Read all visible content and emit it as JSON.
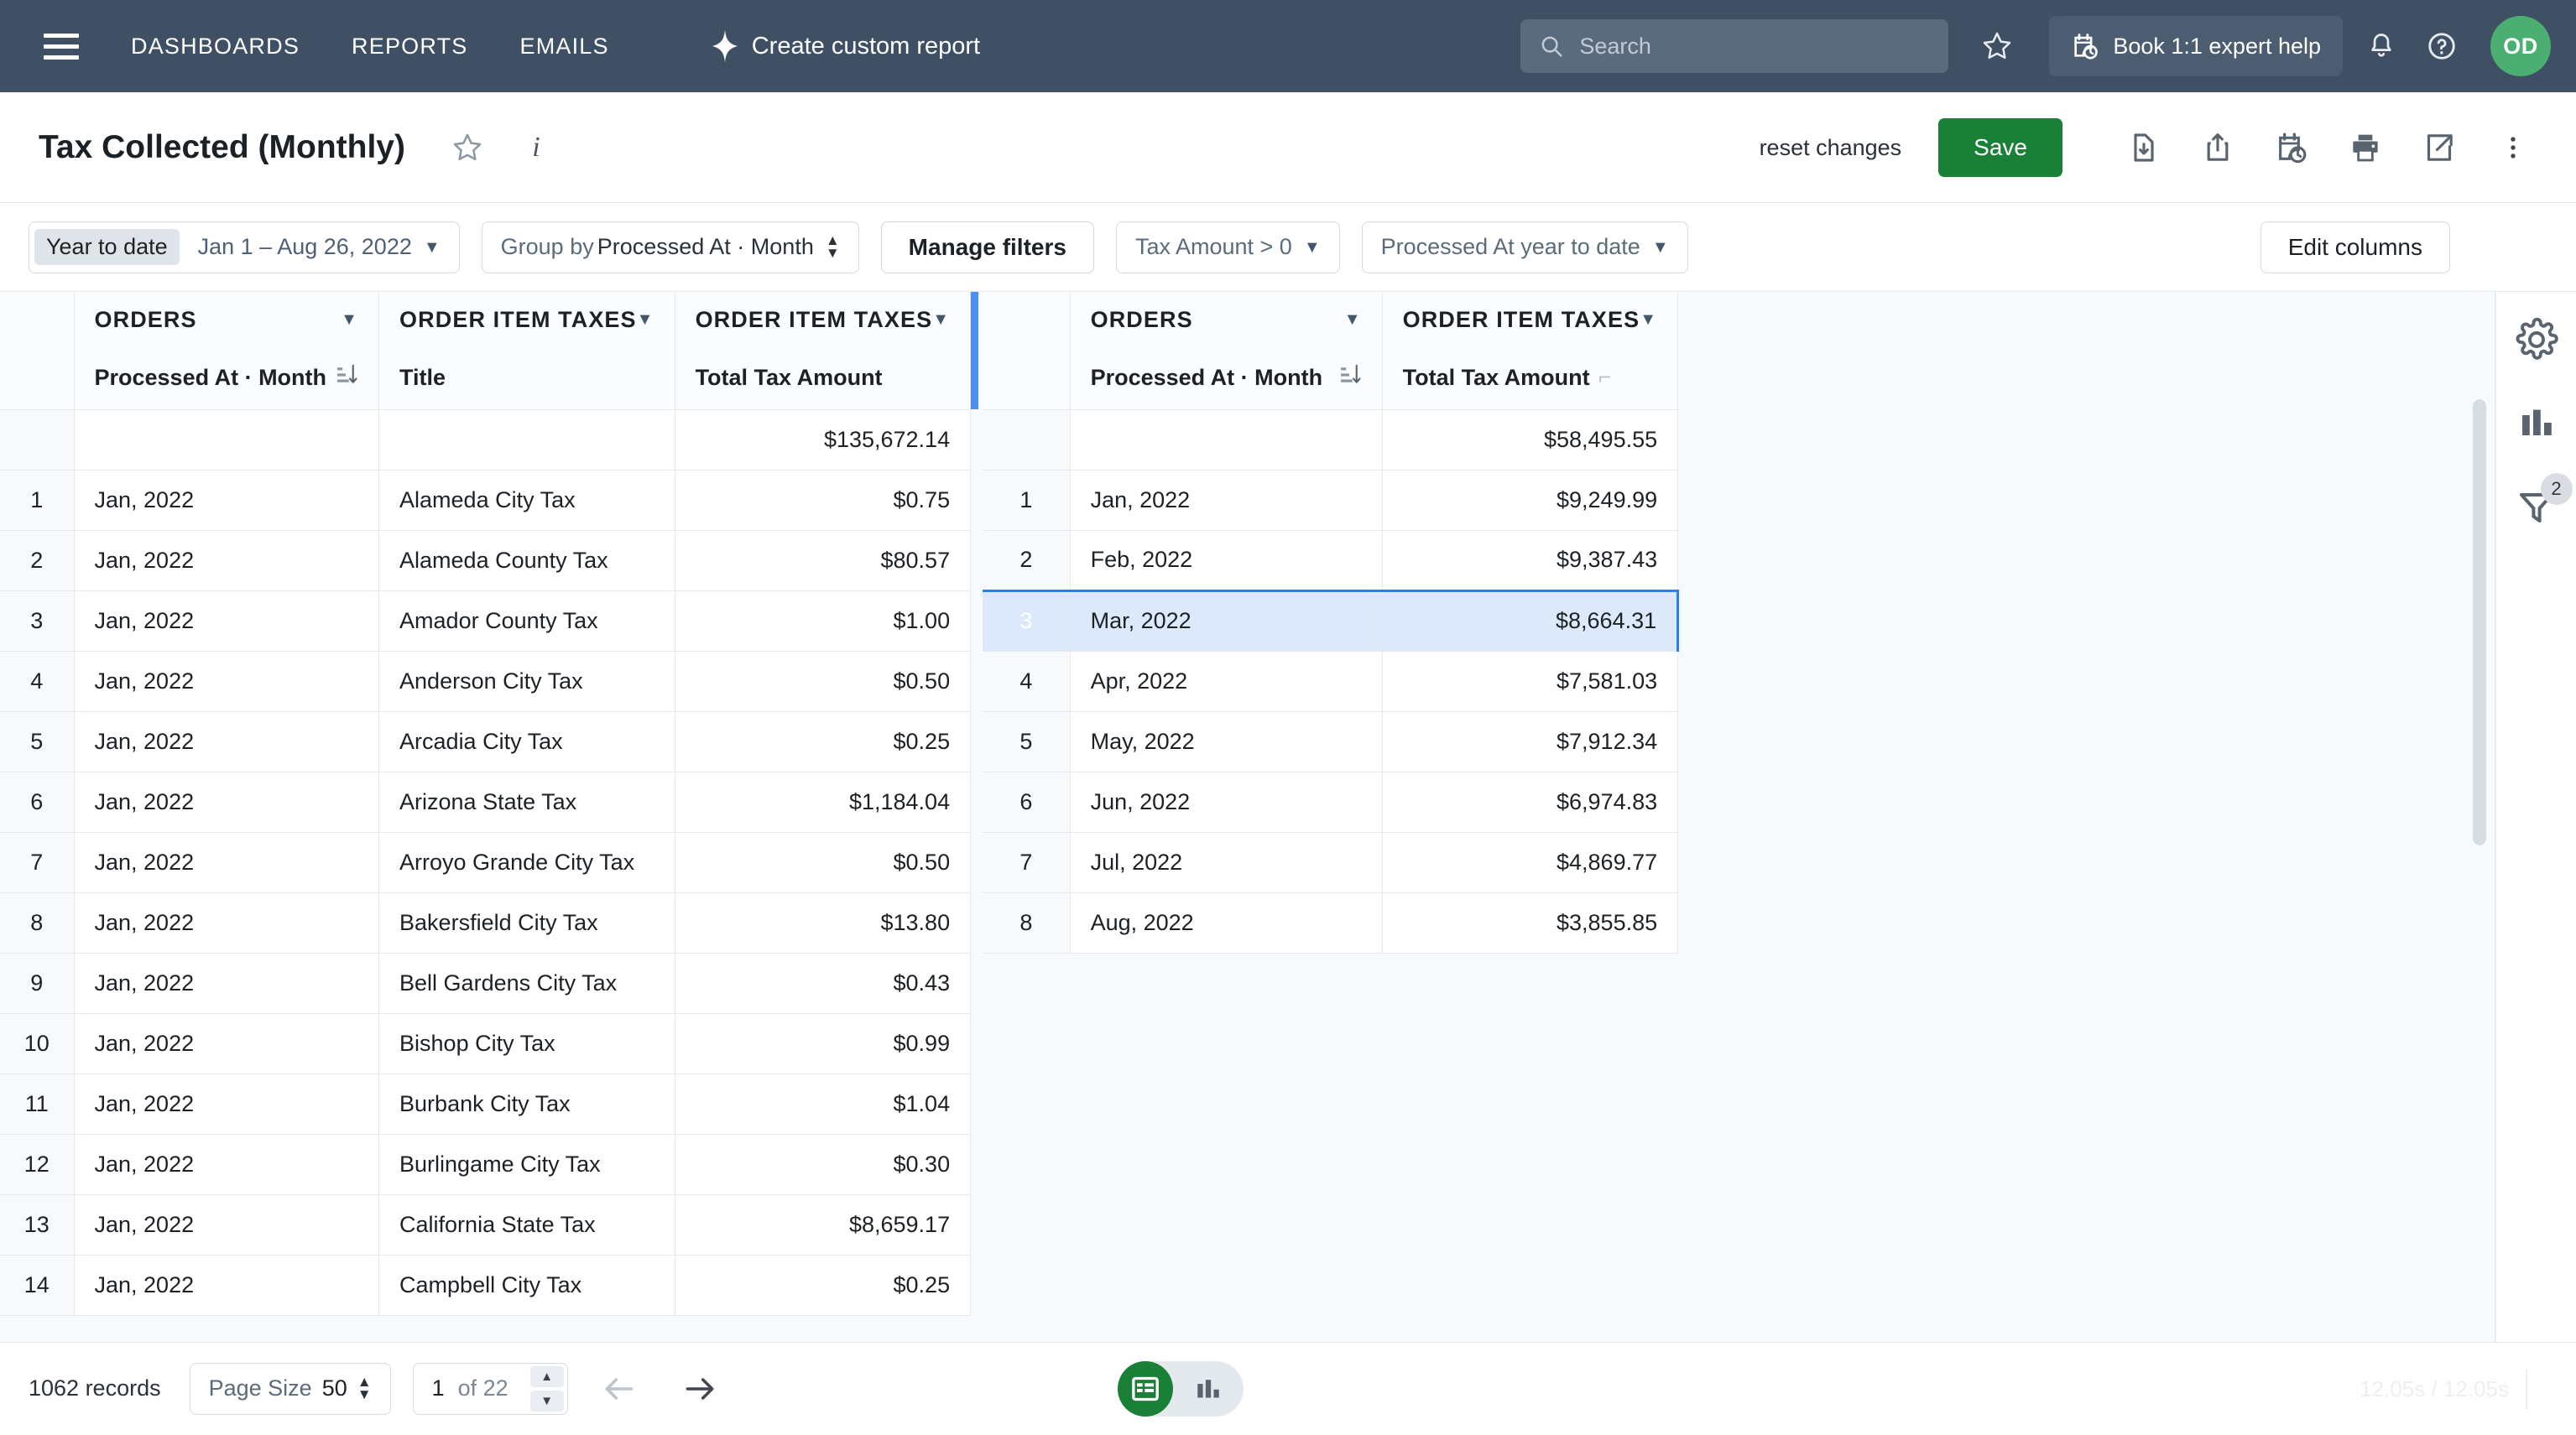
{
  "topnav": {
    "menu_icon": "hamburger-icon",
    "links": [
      "DASHBOARDS",
      "REPORTS",
      "EMAILS"
    ],
    "create_report_label": "Create custom report",
    "create_report_icon": "sparkle-icon",
    "search_placeholder": "Search",
    "search_value": "",
    "search_icon": "search-icon",
    "favorites_icon": "star-icon",
    "book_help_label": "Book 1:1 expert help",
    "book_help_icon": "calendar-clock-icon",
    "notifications_icon": "bell-icon",
    "help_icon": "question-circle-icon",
    "avatar_initials": "OD",
    "avatar_color": "#4caf72"
  },
  "titlebar": {
    "title": "Tax Collected (Monthly)",
    "favorite_icon": "star-icon",
    "info_icon": "info-icon",
    "reset_label": "reset changes",
    "save_label": "Save",
    "save_color": "#1a8038",
    "tools": [
      "download-file-icon",
      "share-upload-icon",
      "schedule-clock-icon",
      "print-icon",
      "open-external-icon",
      "more-vertical-icon"
    ]
  },
  "filterbar": {
    "date_chip": "Year to date",
    "date_range": "Jan 1 – Aug 26, 2022",
    "group_by_prefix": "Group by ",
    "group_by_value": "Processed At · Month",
    "manage_filters": "Manage filters",
    "filters": [
      "Tax Amount > 0",
      "Processed At year to date"
    ],
    "edit_columns": "Edit columns"
  },
  "left_table": {
    "groups": [
      "ORDERS",
      "ORDER ITEM TAXES",
      "ORDER ITEM TAXES"
    ],
    "columns": [
      "Processed At · Month",
      "Title",
      "Total Tax Amount"
    ],
    "totals": [
      "",
      "",
      "$135,672.14"
    ],
    "rows": [
      {
        "n": "1",
        "month": "Jan, 2022",
        "title": "Alameda City Tax",
        "amount": "$0.75"
      },
      {
        "n": "2",
        "month": "Jan, 2022",
        "title": "Alameda County Tax",
        "amount": "$80.57"
      },
      {
        "n": "3",
        "month": "Jan, 2022",
        "title": "Amador County Tax",
        "amount": "$1.00"
      },
      {
        "n": "4",
        "month": "Jan, 2022",
        "title": "Anderson City Tax",
        "amount": "$0.50"
      },
      {
        "n": "5",
        "month": "Jan, 2022",
        "title": "Arcadia City Tax",
        "amount": "$0.25"
      },
      {
        "n": "6",
        "month": "Jan, 2022",
        "title": "Arizona State Tax",
        "amount": "$1,184.04"
      },
      {
        "n": "7",
        "month": "Jan, 2022",
        "title": "Arroyo Grande City Tax",
        "amount": "$0.50"
      },
      {
        "n": "8",
        "month": "Jan, 2022",
        "title": "Bakersfield City Tax",
        "amount": "$13.80"
      },
      {
        "n": "9",
        "month": "Jan, 2022",
        "title": "Bell Gardens City Tax",
        "amount": "$0.43"
      },
      {
        "n": "10",
        "month": "Jan, 2022",
        "title": "Bishop City Tax",
        "amount": "$0.99"
      },
      {
        "n": "11",
        "month": "Jan, 2022",
        "title": "Burbank City Tax",
        "amount": "$1.04"
      },
      {
        "n": "12",
        "month": "Jan, 2022",
        "title": "Burlingame City Tax",
        "amount": "$0.30"
      },
      {
        "n": "13",
        "month": "Jan, 2022",
        "title": "California State Tax",
        "amount": "$8,659.17"
      },
      {
        "n": "14",
        "month": "Jan, 2022",
        "title": "Campbell City Tax",
        "amount": "$0.25"
      }
    ]
  },
  "right_table": {
    "groups": [
      "ORDERS",
      "ORDER ITEM TAXES"
    ],
    "columns": [
      "Processed At · Month",
      "Total Tax Amount"
    ],
    "totals": [
      "",
      "$58,495.55"
    ],
    "selected_row_index": 2,
    "rows": [
      {
        "n": "1",
        "month": "Jan, 2022",
        "amount": "$9,249.99"
      },
      {
        "n": "2",
        "month": "Feb, 2022",
        "amount": "$9,387.43"
      },
      {
        "n": "3",
        "month": "Mar, 2022",
        "amount": "$8,664.31"
      },
      {
        "n": "4",
        "month": "Apr, 2022",
        "amount": "$7,581.03"
      },
      {
        "n": "5",
        "month": "May, 2022",
        "amount": "$7,912.34"
      },
      {
        "n": "6",
        "month": "Jun, 2022",
        "amount": "$6,974.83"
      },
      {
        "n": "7",
        "month": "Jul, 2022",
        "amount": "$4,869.77"
      },
      {
        "n": "8",
        "month": "Aug, 2022",
        "amount": "$3,855.85"
      }
    ]
  },
  "rail": {
    "settings_icon": "gear-icon",
    "chart_icon": "bar-chart-icon",
    "filter_icon": "funnel-icon",
    "filter_badge": "2"
  },
  "footer": {
    "records": "1062 records",
    "page_size_label": "Page Size",
    "page_size_value": "50",
    "page_current": "1",
    "page_of": "of 22",
    "prev_icon": "arrow-left-icon",
    "next_icon": "arrow-right-icon",
    "view_table_icon": "table-view-icon",
    "view_chart_icon": "chart-view-icon",
    "timing": "12.05s / 12.05s"
  }
}
